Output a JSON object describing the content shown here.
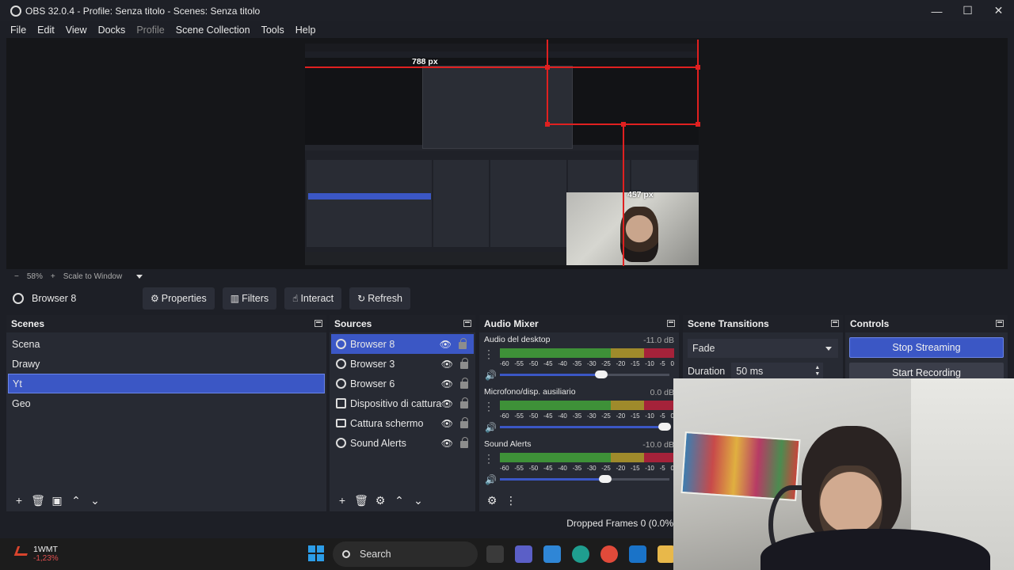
{
  "window": {
    "title": "OBS 32.0.4 - Profile: Senza titolo - Scenes: Senza titolo",
    "minimize": "—",
    "maximize": "☐",
    "close": "✕"
  },
  "menu": [
    "File",
    "Edit",
    "View",
    "Docks",
    "Profile",
    "Scene Collection",
    "Tools",
    "Help"
  ],
  "preview": {
    "width_label": "788 px",
    "height_label": "457 px"
  },
  "zoom": {
    "minus": "−",
    "value": "58%",
    "plus": "+",
    "mode": "Scale to Window"
  },
  "context": {
    "source": "Browser 8",
    "buttons": [
      "Properties",
      "Filters",
      "Interact",
      "Refresh"
    ]
  },
  "scenes": {
    "title": "Scenes",
    "items": [
      "Scena",
      "Drawy",
      "Yt",
      "Geo"
    ],
    "active_index": 2
  },
  "sources": {
    "title": "Sources",
    "items": [
      {
        "name": "Browser 8",
        "icon": "globe-icon"
      },
      {
        "name": "Browser 3",
        "icon": "globe-icon"
      },
      {
        "name": "Browser 6",
        "icon": "globe-icon"
      },
      {
        "name": "Dispositivo di cattura",
        "icon": "camera-icon"
      },
      {
        "name": "Cattura schermo",
        "icon": "monitor-icon"
      },
      {
        "name": "Sound Alerts",
        "icon": "globe-icon"
      }
    ]
  },
  "mixer": {
    "title": "Audio Mixer",
    "scale": [
      "-60",
      "-55",
      "-50",
      "-45",
      "-40",
      "-35",
      "-30",
      "-25",
      "-20",
      "-15",
      "-10",
      "-5",
      "0"
    ],
    "channels": [
      {
        "name": "Audio del desktop",
        "db": "-11.0 dB",
        "volume": 0.6
      },
      {
        "name": "Microfono/disp. ausiliario",
        "db": "0.0 dB",
        "volume": 1.0
      },
      {
        "name": "Sound Alerts",
        "db": "-10.0 dB",
        "volume": 0.62
      }
    ]
  },
  "transitions": {
    "title": "Scene Transitions",
    "selected": "Fade",
    "duration_label": "Duration",
    "duration_value": "50 ms"
  },
  "controls": {
    "title": "Controls",
    "stop_streaming": "Stop Streaming",
    "start_recording": "Start Recording"
  },
  "status": {
    "dropped": "Dropped Frames 0 (0.0%)"
  },
  "taskbar": {
    "stock_name": "1WMT",
    "stock_change": "-1,23%",
    "search_placeholder": "Search"
  },
  "colors": {
    "accent": "#3b57c5",
    "meter_green": "#3e9138",
    "meter_yellow": "#9f8a2b",
    "meter_red": "#a5223a"
  }
}
